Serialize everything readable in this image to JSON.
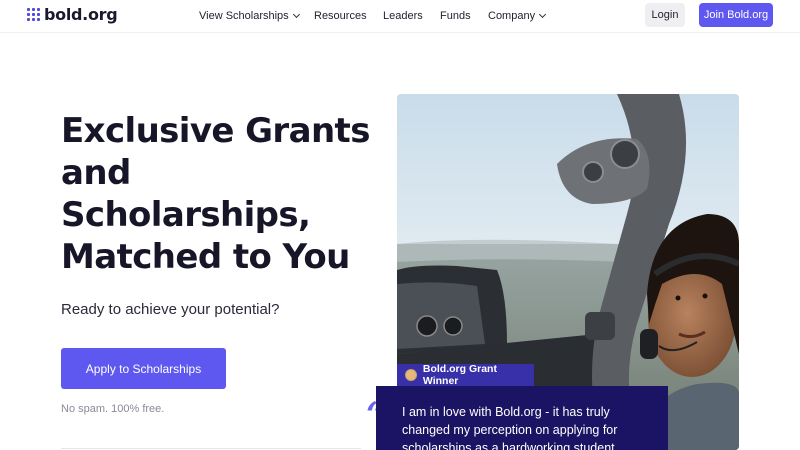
{
  "brand": {
    "name": "bold.org",
    "accent": "#5f58f0",
    "navy": "#1b1363"
  },
  "nav": {
    "items": [
      {
        "label": "View Scholarships",
        "dropdown": true
      },
      {
        "label": "Resources",
        "dropdown": false
      },
      {
        "label": "Leaders",
        "dropdown": false
      },
      {
        "label": "Funds",
        "dropdown": false
      },
      {
        "label": "Company",
        "dropdown": true
      }
    ],
    "login_label": "Login",
    "join_label": "Join Bold.org"
  },
  "hero": {
    "title_lines": [
      "Exclusive Grants",
      "and",
      "Scholarships,",
      "Matched to You"
    ],
    "subtitle": "Ready to achieve your potential?",
    "cta_label": "Apply to Scholarships",
    "fine_print": "No spam. 100% free."
  },
  "testimonial": {
    "badge_label": "Bold.org Grant Winner",
    "badge_icon": "medal-icon",
    "quote_lines": [
      "I am in love with Bold.org - it has truly",
      "changed my perception on applying for",
      "scholarships as a hardworking student"
    ]
  }
}
